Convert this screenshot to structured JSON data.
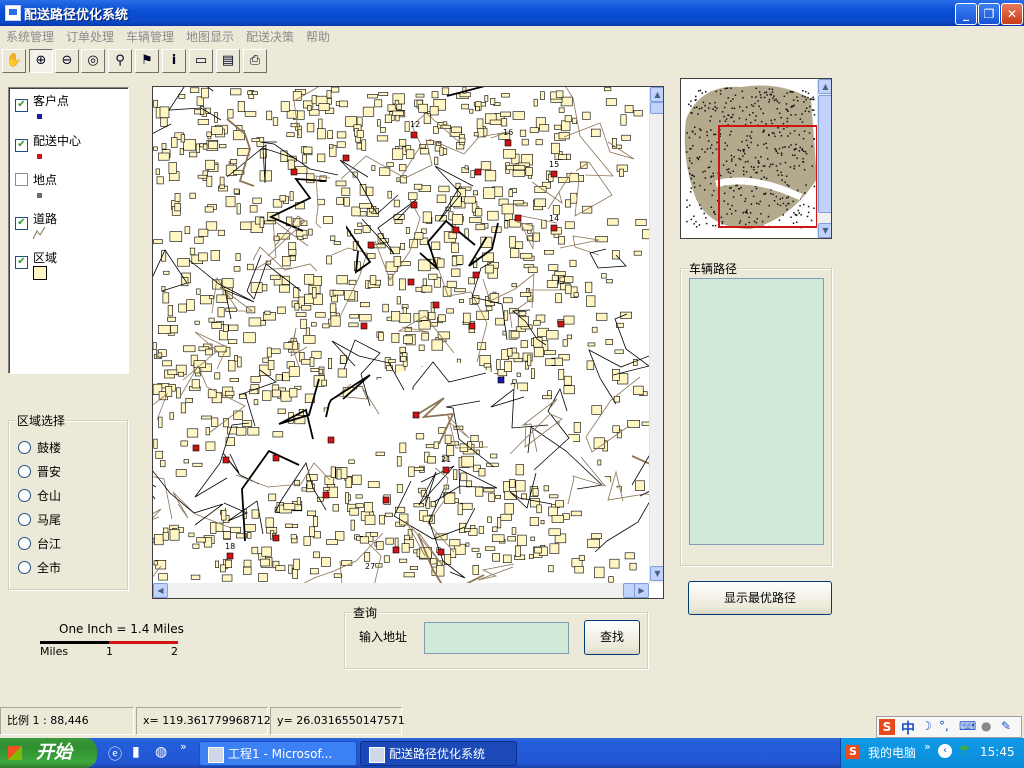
{
  "window": {
    "title": "配送路径优化系统",
    "controls": {
      "minimize": "_",
      "restore": "❐",
      "close": "✕"
    }
  },
  "menu": [
    "系统管理",
    "订单处理",
    "车辆管理",
    "地图显示",
    "配送决策",
    "帮助"
  ],
  "toolbar": {
    "icons": [
      "pan-hand-icon",
      "zoom-in-icon",
      "zoom-out-icon",
      "full-extent-icon",
      "binoculars-icon",
      "flag-icon",
      "info-icon",
      "label-icon",
      "properties-icon",
      "print-icon"
    ],
    "pressed_index": 1
  },
  "layers": [
    {
      "label": "客户点",
      "checked": true,
      "symbol": "point",
      "color": "#1a1aa8"
    },
    {
      "label": "配送中心",
      "checked": true,
      "symbol": "point",
      "color": "#d01414"
    },
    {
      "label": "地点",
      "checked": false,
      "symbol": "point",
      "color": "#6c6c6c"
    },
    {
      "label": "道路",
      "checked": true,
      "symbol": "line",
      "color": "#8b7355"
    },
    {
      "label": "区域",
      "checked": true,
      "symbol": "polygon",
      "color": "#fff6c4"
    }
  ],
  "region": {
    "title": "区域选择",
    "options": [
      "鼓楼",
      "晋安",
      "仓山",
      "马尾",
      "台江",
      "全市"
    ]
  },
  "scalebar": {
    "text": "One Inch = 1.4 Miles",
    "unit": "Miles",
    "ticks": [
      "1",
      "2"
    ]
  },
  "map": {
    "labels": [
      "12",
      "16",
      "15",
      "14",
      "18",
      "21",
      "27"
    ],
    "land_color": "#fff6c4",
    "road_color": "#8b7355"
  },
  "overview": {
    "extent_color": "#d01414"
  },
  "route": {
    "title": "车辆路径",
    "button": "显示最优路径",
    "box_color": "#d1e9d7"
  },
  "search": {
    "title": "查询",
    "label": "输入地址",
    "value": "",
    "button": "查找"
  },
  "status": {
    "scale": "比例  1 : 88,446",
    "x": "x= 119.361779968712",
    "y": "y= 26.0316550147571"
  },
  "taskbar": {
    "start": "开始",
    "tasks": [
      "工程1 - Microsof...",
      "配送路径优化系统"
    ],
    "tray_label": "我的电脑",
    "clock": "15:45",
    "ime": "中"
  }
}
